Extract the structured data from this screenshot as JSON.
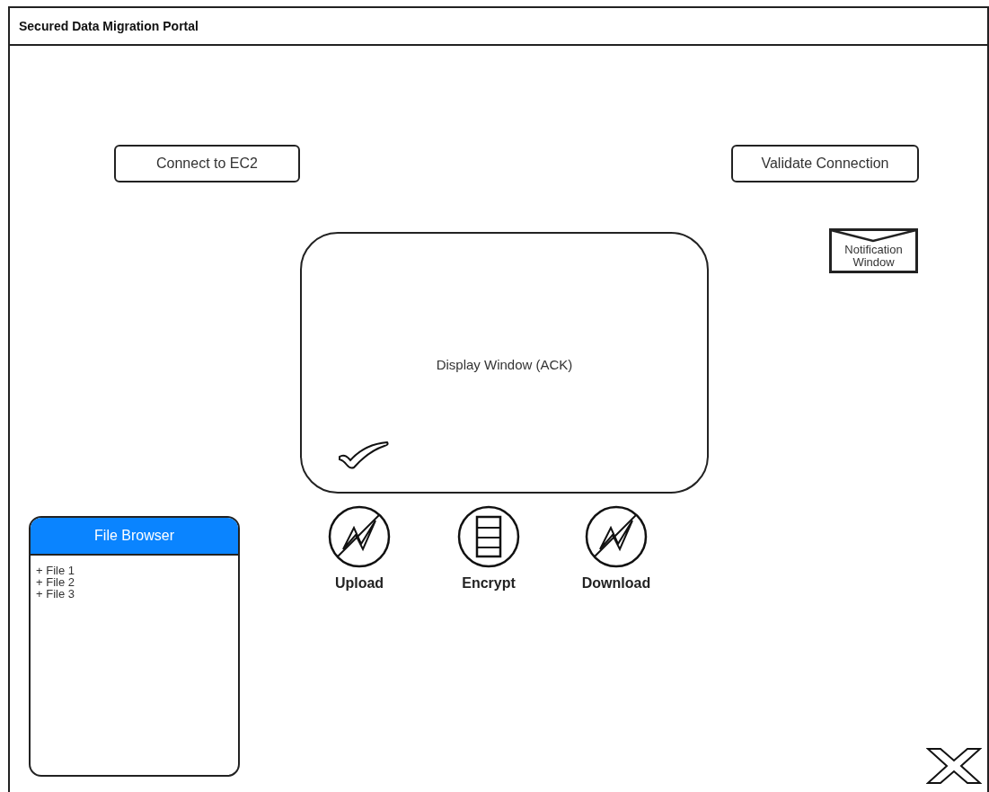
{
  "window": {
    "title": "Secured Data Migration Portal"
  },
  "buttons": [
    {
      "label": "Connect to EC2"
    },
    {
      "label": "Validate Connection"
    }
  ],
  "notification": {
    "label": "Notification Window"
  },
  "display_window": {
    "label": "Display Window (ACK)"
  },
  "actions": [
    {
      "label": "Upload",
      "kind": "bolt"
    },
    {
      "label": "Encrypt",
      "kind": "document"
    },
    {
      "label": "Download",
      "kind": "bolt"
    }
  ],
  "file_browser": {
    "title": "File Browser",
    "items": [
      "+ File 1",
      "+ File 2",
      "+ File 3"
    ]
  }
}
